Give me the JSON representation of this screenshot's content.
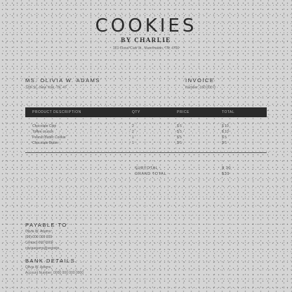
{
  "brand": {
    "title": "COOKIES",
    "subtitle": "BY CHARLIE",
    "address": "123 Cloud Club St., Mannhattan, TN, 4700"
  },
  "bill_to": {
    "name": "MS. OLIVIA W. ADAMS",
    "address": "12th St., New York, TN, 47"
  },
  "invoice": {
    "label": "INVOICE",
    "number": "Number: 160 000 0"
  },
  "table": {
    "headers": [
      "PRODUCT DESCRIPTION",
      "QTY",
      "PRICE",
      "TOTAL"
    ],
    "rows": [
      [
        "Chocolate Chip",
        "2",
        "$ 5",
        "$ 10"
      ],
      [
        "Toffee crunch",
        "2",
        "$ 5",
        "$ 10"
      ],
      [
        "Peanut Butter Cookie",
        "1",
        "$ 5",
        "$ 5"
      ],
      [
        "Chocolate Butter",
        "1",
        "$ 5",
        "$ 5"
      ]
    ]
  },
  "totals": {
    "subtotal_label": "SUBTOTAL",
    "subtotal_value": "$ 30",
    "grand_label": "GRAND TOTAL",
    "grand_value": "$30"
  },
  "payable": {
    "title": "PAYABLE TO",
    "lines": [
      "Olivia W. Adams",
      "(00) 000 000 000",
      "Contact 000 0000",
      "oliviaadams@website"
    ]
  },
  "bank": {
    "title": "BANK DETAILS",
    "lines": [
      "Olivia W. Adams",
      "Account Number: 0000 000 000 0000"
    ]
  }
}
